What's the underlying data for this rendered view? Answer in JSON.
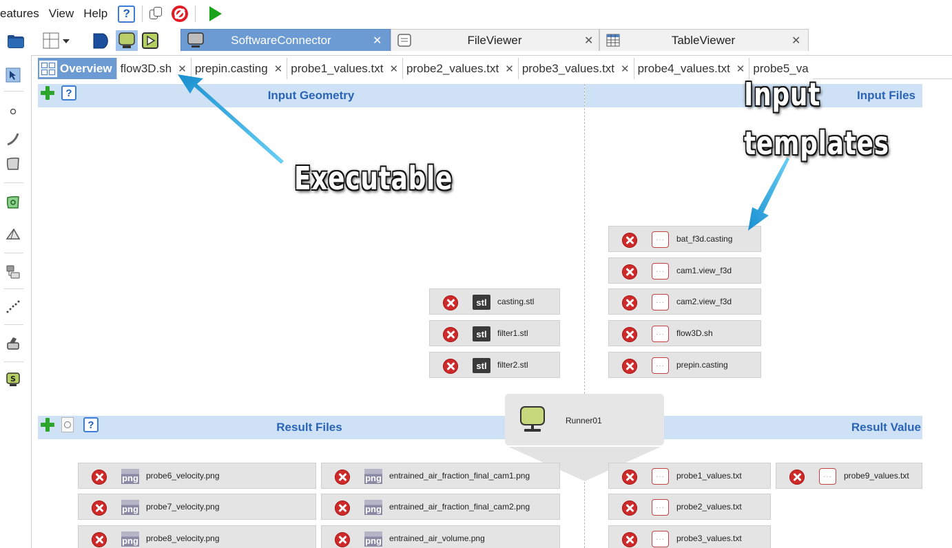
{
  "menu": {
    "items": [
      "eatures",
      "View",
      "Help"
    ],
    "help_label": "?"
  },
  "window_tabs": [
    {
      "label": "SoftwareConnector",
      "close": "✕",
      "icon": "monitor-icon"
    },
    {
      "label": "FileViewer",
      "close": "✕",
      "icon": "document-icon"
    },
    {
      "label": "TableViewer",
      "close": "✕",
      "icon": "table-icon"
    }
  ],
  "doc_tabs": [
    {
      "label": "Overview",
      "close": ""
    },
    {
      "label": "flow3D.sh",
      "close": "✕"
    },
    {
      "label": "prepin.casting",
      "close": "✕"
    },
    {
      "label": "probe1_values.txt",
      "close": "✕"
    },
    {
      "label": "probe2_values.txt",
      "close": "✕"
    },
    {
      "label": "probe3_values.txt",
      "close": "✕"
    },
    {
      "label": "probe4_values.txt",
      "close": "✕"
    },
    {
      "label": "probe5_va",
      "close": ""
    }
  ],
  "sections": {
    "input_geometry": "Input Geometry",
    "input_files": "Input Files",
    "result_files": "Result Files",
    "result_values": "Result Value",
    "help": "?"
  },
  "geometry_files": [
    {
      "name": "casting.stl",
      "badge": "stl"
    },
    {
      "name": "filter1.stl",
      "badge": "stl"
    },
    {
      "name": "filter2.stl",
      "badge": "stl"
    }
  ],
  "input_files": [
    {
      "name": "bat_f3d.casting"
    },
    {
      "name": "cam1.view_f3d"
    },
    {
      "name": "cam2.view_f3d"
    },
    {
      "name": "flow3D.sh"
    },
    {
      "name": "prepin.casting"
    }
  ],
  "runner": {
    "label": "Runner01"
  },
  "result_files_col1": [
    {
      "name": "probe6_velocity.png",
      "badge": "png"
    },
    {
      "name": "probe7_velocity.png",
      "badge": "png"
    },
    {
      "name": "probe8_velocity.png",
      "badge": "png"
    }
  ],
  "result_files_col2": [
    {
      "name": "entrained_air_fraction_final_cam1.png",
      "badge": "png"
    },
    {
      "name": "entrained_air_fraction_final_cam2.png",
      "badge": "png"
    },
    {
      "name": "entrained_air_volume.png",
      "badge": "png"
    }
  ],
  "result_values_col1": [
    {
      "name": "probe1_values.txt"
    },
    {
      "name": "probe2_values.txt"
    },
    {
      "name": "probe3_values.txt"
    }
  ],
  "result_values_col2": [
    {
      "name": "probe9_values.txt"
    }
  ],
  "annotations": {
    "executable": "Executable",
    "input_line1": "Input",
    "input_line2": "templates"
  },
  "colors": {
    "active_tab": "#6c9ad3",
    "section_header": "#cfe1f5",
    "arrow": "#35b4ec"
  }
}
